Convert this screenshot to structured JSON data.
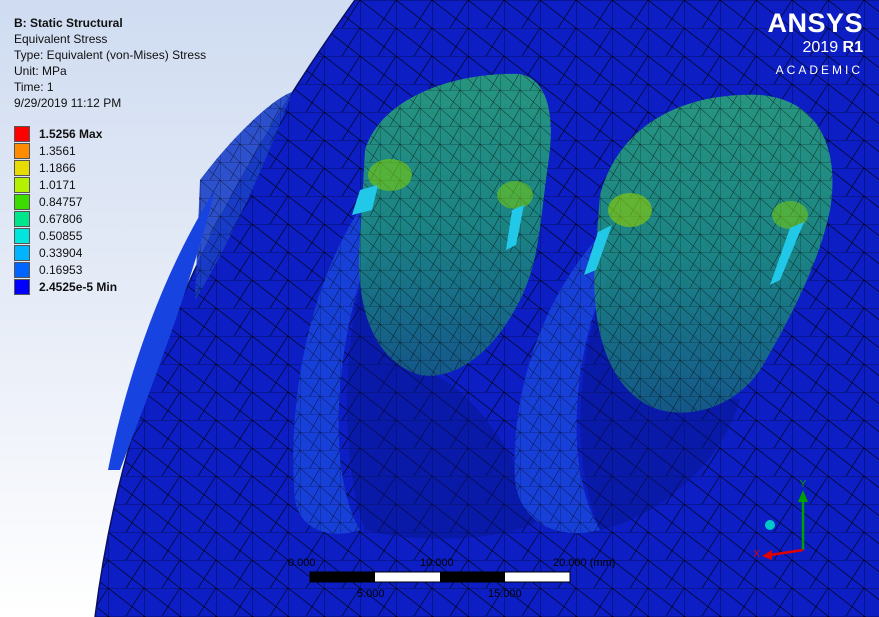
{
  "result": {
    "title": "B: Static Structural",
    "type_name": "Equivalent Stress",
    "type_line": "Type: Equivalent (von-Mises) Stress",
    "unit_line": "Unit: MPa",
    "time_line": "Time: 1",
    "timestamp": "9/29/2019 11:12 PM"
  },
  "legend": {
    "items": [
      {
        "label": "1.5256 Max",
        "color": "#ff0000",
        "bold": true
      },
      {
        "label": "1.3561",
        "color": "#ff8c00",
        "bold": false
      },
      {
        "label": "1.1866",
        "color": "#e6dc00",
        "bold": false
      },
      {
        "label": "1.0171",
        "color": "#b4f000",
        "bold": false
      },
      {
        "label": "0.84757",
        "color": "#3cdc00",
        "bold": false
      },
      {
        "label": "0.67806",
        "color": "#00e68c",
        "bold": false
      },
      {
        "label": "0.50855",
        "color": "#00e6dc",
        "bold": false
      },
      {
        "label": "0.33904",
        "color": "#00b4ff",
        "bold": false
      },
      {
        "label": "0.16953",
        "color": "#0064ff",
        "bold": false
      },
      {
        "label": "2.4525e-5 Min",
        "color": "#0000ff",
        "bold": true
      }
    ]
  },
  "logo": {
    "brand": "ANSYS",
    "version": "2019",
    "release": "R1",
    "edition": "ACADEMIC"
  },
  "scale_bar": {
    "top_labels": [
      "0.000",
      "10.000",
      "20.000 (mm)"
    ],
    "bottom_labels": [
      "5.000",
      "15.000"
    ]
  },
  "triad": {
    "y_label": "Y",
    "x_label": "X",
    "y_color": "#00a000",
    "x_color": "#e00000",
    "iso_color": "#00c8c8"
  },
  "colors": {
    "model_blue": "#0d1fc4",
    "mesh_line": "#000000"
  }
}
